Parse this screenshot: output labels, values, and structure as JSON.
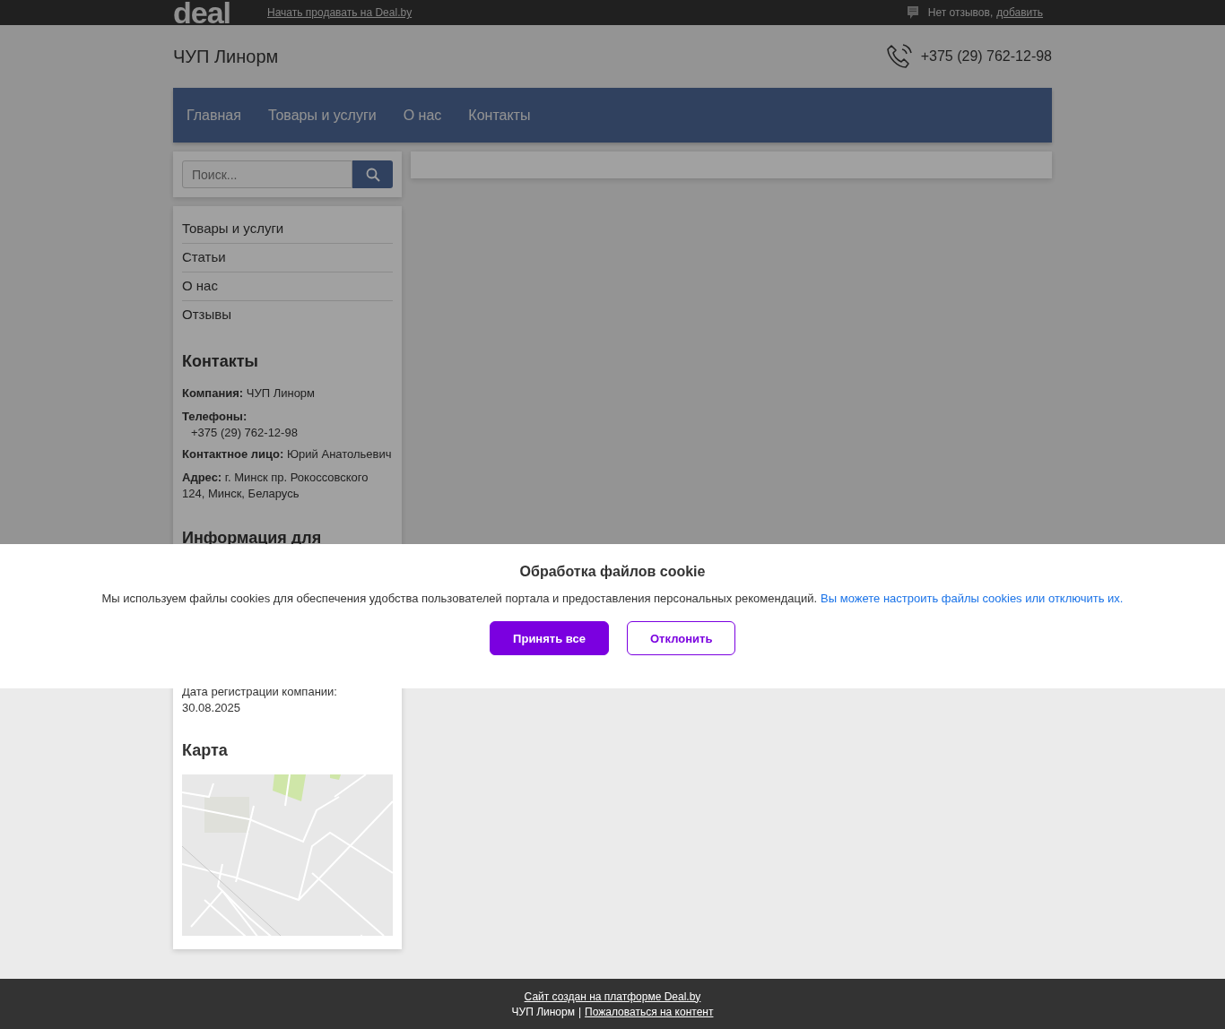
{
  "top_bar": {
    "logo": "deal",
    "sell_link": "Начать продавать на Deal.by",
    "reviews_text": "Нет отзывов,",
    "reviews_link": "добавить"
  },
  "header": {
    "company": "ЧУП Линорм",
    "phone": "+375 (29) 762-12-98"
  },
  "nav": [
    {
      "label": "Главная"
    },
    {
      "label": "Товары и услуги"
    },
    {
      "label": "О нас"
    },
    {
      "label": "Контакты"
    }
  ],
  "search": {
    "placeholder": "Поиск..."
  },
  "sidebar": {
    "menu": [
      {
        "label": "Товары и услуги"
      },
      {
        "label": "Статьи"
      },
      {
        "label": "О нас"
      },
      {
        "label": "Отзывы"
      }
    ],
    "contacts": {
      "title": "Контакты",
      "rows": [
        {
          "kind": "field",
          "text": "**Компания:** ЧУП Линорм"
        },
        {
          "kind": "label",
          "text": "Телефоны:"
        },
        {
          "kind": "value",
          "text": "+375 (29) 762-12-98"
        },
        {
          "kind": "field",
          "text": "**Контактное лицо:** Юрий Анатольевич"
        },
        {
          "kind": "field",
          "text": "**Адрес:** г. Минск пр. Рокоссовского 124, Минск, Беларусь"
        }
      ]
    },
    "info": {
      "title": "Информация для",
      "registration_label": "Дата регистрации компании:",
      "registration_date": "30.08.2025"
    },
    "map": {
      "title": "Карта",
      "kind": "picture"
    }
  },
  "cookie": {
    "title": "Обработка файлов cookie",
    "text": "Мы используем файлы cookies для обеспечения удобства пользователей портала и предоставления персональных рекомендаций.",
    "link": "Вы можете настроить файлы cookies или отключить их.",
    "buttons": [
      {
        "label": "Принять все",
        "kind": "primary"
      },
      {
        "label": "Отклонить",
        "kind": "secondary"
      }
    ]
  },
  "footer": {
    "platform_link": "Сайт создан на платформе Deal.by",
    "company": "ЧУП Линорм",
    "separator": "|",
    "complaint_link": "Пожаловаться на контент"
  }
}
